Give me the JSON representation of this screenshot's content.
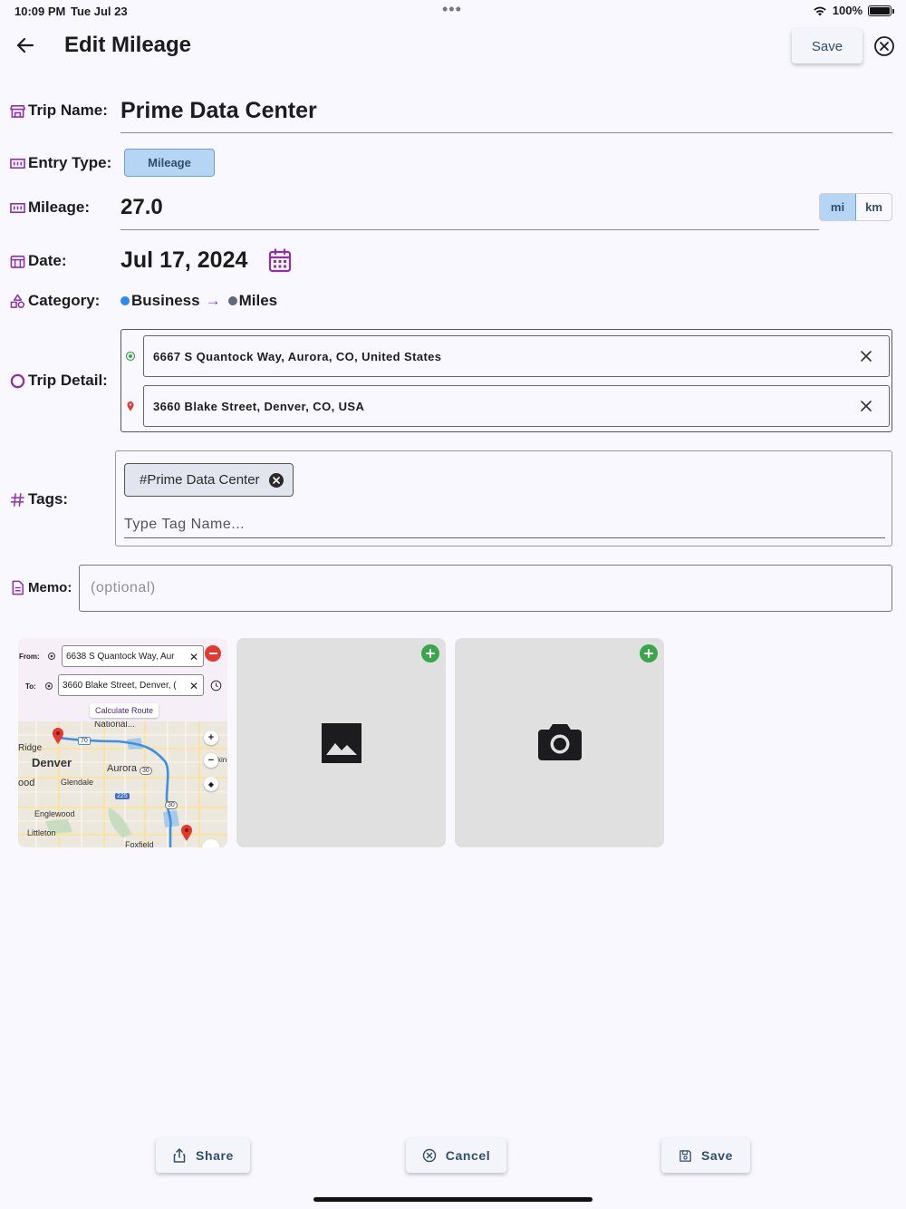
{
  "status_bar": {
    "time": "10:09 PM",
    "date": "Tue Jul 23",
    "battery": "100%"
  },
  "header": {
    "title": "Edit Mileage",
    "save_label": "Save"
  },
  "fields": {
    "trip_name": {
      "label": "Trip Name:",
      "value": "Prime Data Center"
    },
    "entry_type": {
      "label": "Entry Type:",
      "value": "Mileage"
    },
    "mileage": {
      "label": "Mileage:",
      "value": "27.0",
      "units": [
        "mi",
        "km"
      ],
      "selected_unit": "mi"
    },
    "date": {
      "label": "Date:",
      "value": "Jul 17, 2024"
    },
    "category": {
      "label": "Category:",
      "from": "Business",
      "from_color": "#2a8cf2",
      "arrow": "→",
      "to": "Miles",
      "to_color": "#5d6b7a"
    },
    "trip_detail": {
      "label": "Trip Detail:",
      "start": "6667 S Quantock Way, Aurora, CO, United States",
      "end": "3660 Blake Street, Denver, CO, USA"
    },
    "tags": {
      "label": "Tags:",
      "chips": [
        "#Prime Data Center"
      ],
      "placeholder": "Type Tag Name..."
    },
    "memo": {
      "label": "Memo:",
      "placeholder": "(optional)"
    }
  },
  "map_preview": {
    "from_label": "From:",
    "from_value": "6638 S Quantock Way, Aur",
    "to_label": "To:",
    "to_value": "3660 Blake Street, Denver, (",
    "calc_route_label": "Calculate Route",
    "places": [
      "National...",
      "Ridge",
      "Denver",
      "Aurora",
      "ood",
      "Glendale",
      "Englewood",
      "Littleton",
      "Foxfield",
      "kins"
    ],
    "highways": [
      "70",
      "30",
      "225",
      "30"
    ]
  },
  "bottom_bar": {
    "share_label": "Share",
    "cancel_label": "Cancel",
    "save_label": "Save"
  },
  "colors": {
    "accent_purple": "#8e2fae",
    "primary_blue": "#b6d4f3",
    "button_text": "#2d4f6c",
    "add_green": "#3aa64a"
  }
}
